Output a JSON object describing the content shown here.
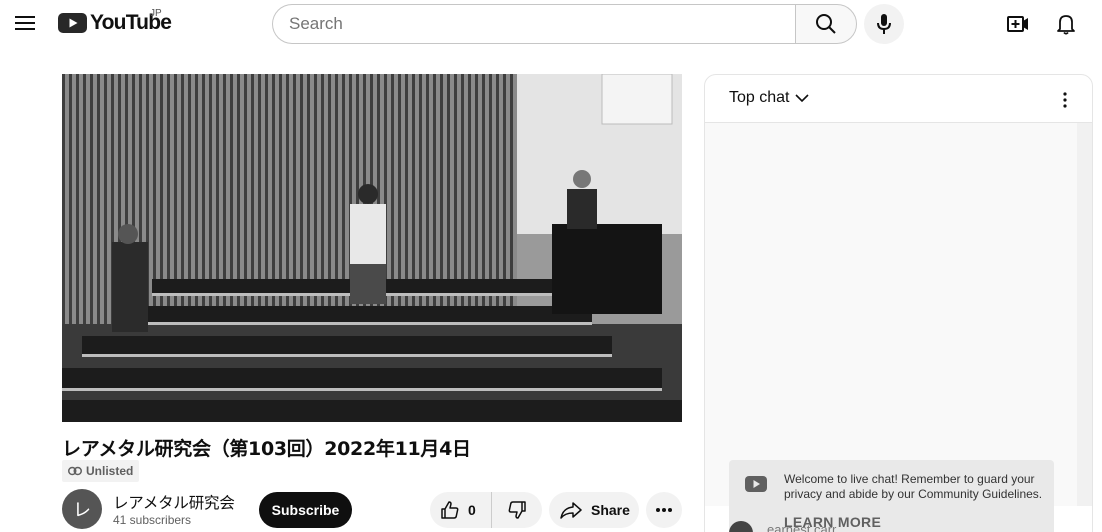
{
  "masthead": {
    "logo_text": "YouTube",
    "region": "JP",
    "search_placeholder": "Search"
  },
  "video": {
    "title": "レアメタル研究会（第103回）2022年11月4日",
    "visibility": "Unlisted"
  },
  "channel": {
    "avatar_letter": "レ",
    "name": "レアメタル研究会",
    "subscribers": "41 subscribers",
    "subscribe_label": "Subscribe"
  },
  "actions": {
    "like_count": "0",
    "share_label": "Share"
  },
  "chat": {
    "mode": "Top chat",
    "notice": "Welcome to live chat! Remember to guard your privacy and abide by our Community Guidelines.",
    "learn_more": "LEARN MORE",
    "first_author": "earnest carr"
  },
  "colors": {
    "brand_red": "#ff0000",
    "subscribe_bg": "#0f0f0f",
    "chip_bg": "#f2f2f2"
  },
  "icons": [
    "menu-icon",
    "youtube-logo-icon",
    "search-icon",
    "mic-icon",
    "create-icon",
    "bell-icon",
    "link-icon",
    "like-icon",
    "dislike-icon",
    "share-icon",
    "more-icon",
    "chevron-down-icon",
    "vertical-dots-icon",
    "youtube-chat-icon"
  ]
}
